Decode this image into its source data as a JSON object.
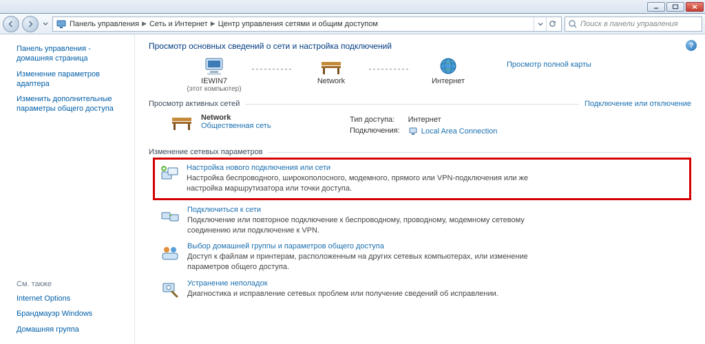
{
  "titlebar": {
    "min": "–",
    "max": "❐",
    "close": "✕"
  },
  "breadcrumb": {
    "root": "Панель управления",
    "mid": "Сеть и Интернет",
    "leaf": "Центр управления сетями и общим доступом"
  },
  "search": {
    "placeholder": "Поиск в панели управления"
  },
  "sidebar": {
    "links": [
      "Панель управления - домашняя страница",
      "Изменение параметров адаптера",
      "Изменить дополнительные параметры общего доступа"
    ],
    "see_also_hdr": "См. также",
    "see_also": [
      "Internet Options",
      "Брандмауэр Windows",
      "Домашняя группа"
    ]
  },
  "content": {
    "heading": "Просмотр основных сведений о сети и настройка подключений",
    "map": {
      "node1": "IEWIN7",
      "node1_sub": "(этот компьютер)",
      "node2": "Network",
      "node3": "Интернет",
      "full_map_link": "Просмотр полной карты"
    },
    "active_hdr": "Просмотр активных сетей",
    "active_rlink": "Подключение или отключение",
    "active": {
      "name": "Network",
      "type": "Общественная сеть",
      "access_lbl": "Тип доступа:",
      "access_val": "Интернет",
      "conn_lbl": "Подключения:",
      "conn_val": "Local Area Connection"
    },
    "settings_hdr": "Изменение сетевых параметров",
    "tasks": [
      {
        "title": "Настройка нового подключения или сети",
        "desc": "Настройка беспроводного, широкополосного, модемного, прямого или VPN-подключения или же настройка маршрутизатора или точки доступа."
      },
      {
        "title": "Подключиться к сети",
        "desc": "Подключение или повторное подключение к беспроводному, проводному, модемному сетевому соединению или подключение к VPN."
      },
      {
        "title": "Выбор домашней группы и параметров общего доступа",
        "desc": "Доступ к файлам и принтерам, расположенным на других сетевых компьютерах, или изменение параметров общего доступа."
      },
      {
        "title": "Устранение неполадок",
        "desc": "Диагностика и исправление сетевых проблем или получение сведений об исправлении."
      }
    ]
  }
}
